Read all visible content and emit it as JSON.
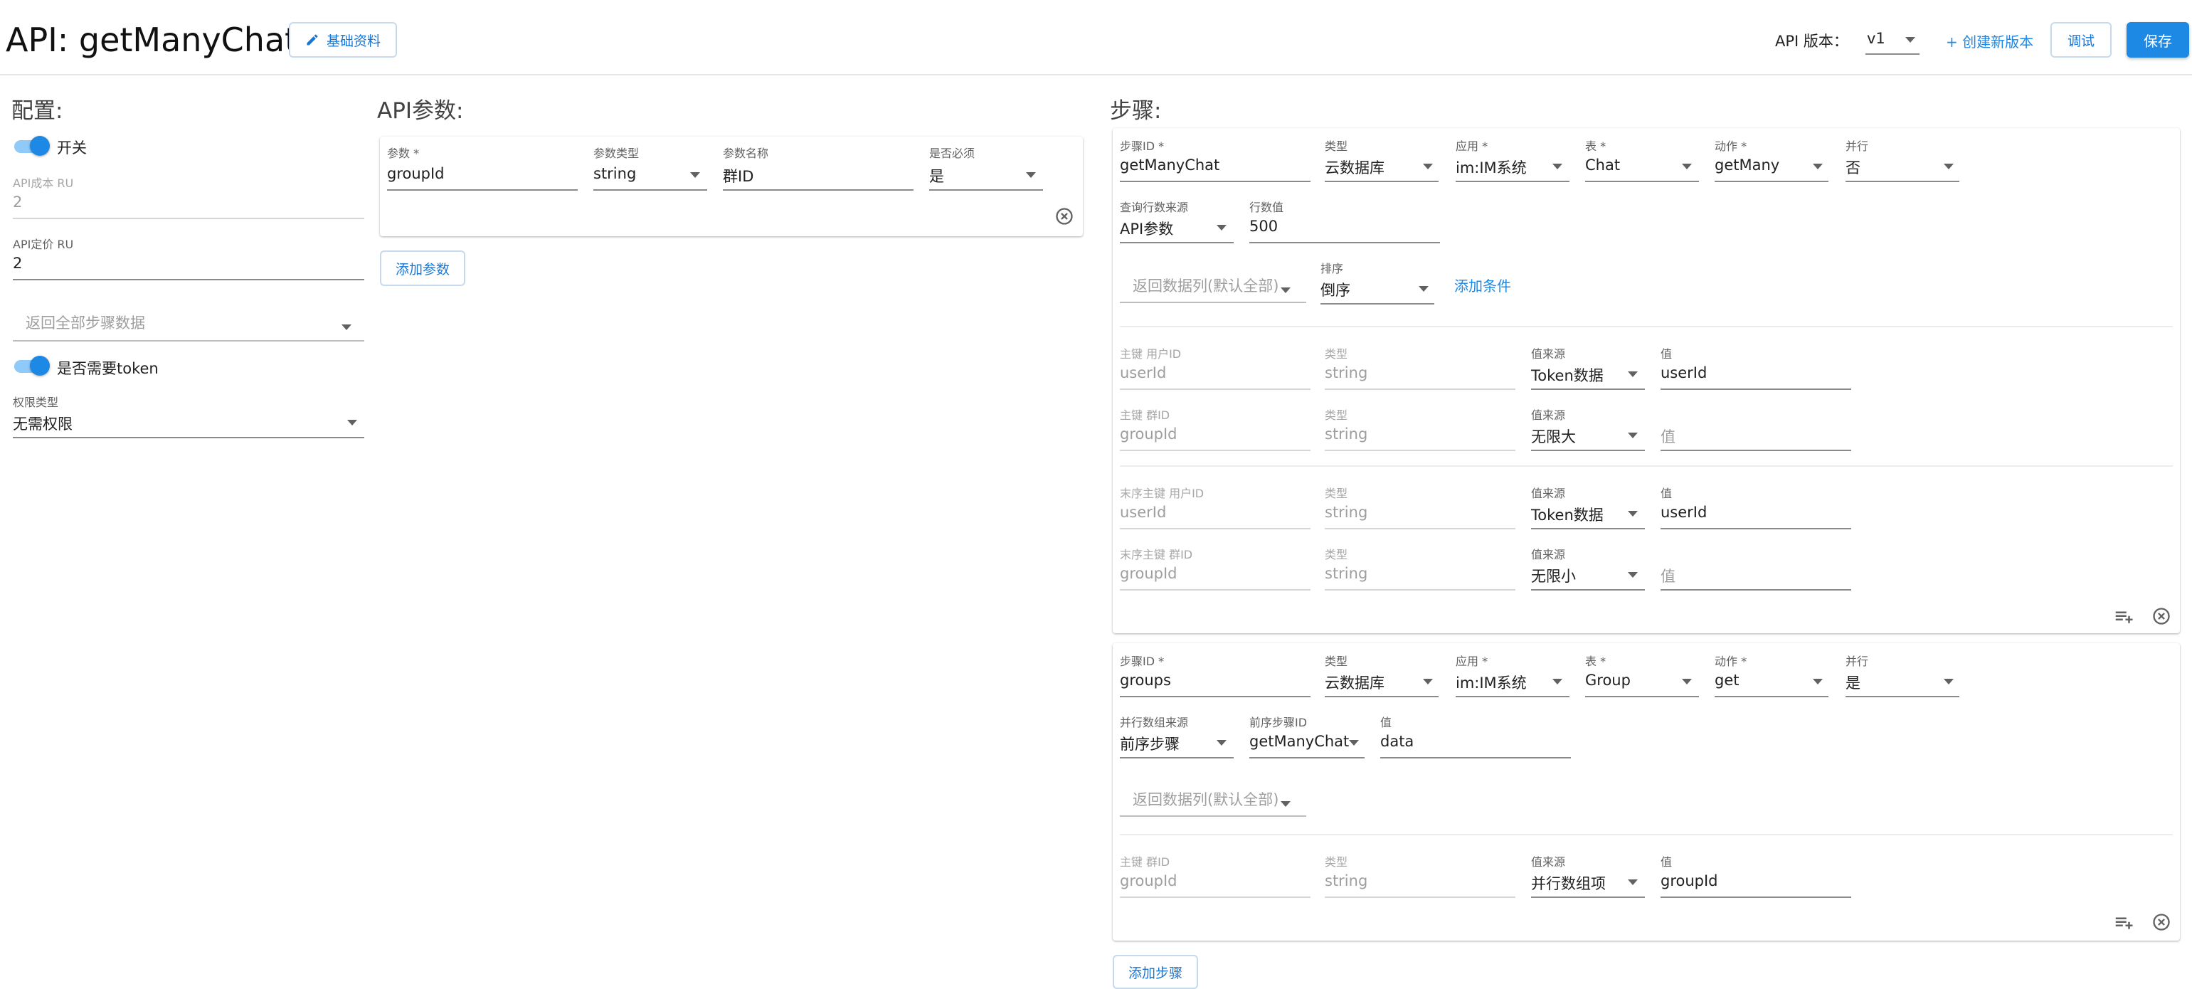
{
  "header": {
    "title": "API: getManyChat",
    "basic_info_label": "基础资料",
    "version_label": "API 版本：",
    "version_value": "v1",
    "create_version_label": "+ 创建新版本",
    "debug_label": "调试",
    "save_label": "保存"
  },
  "config": {
    "title": "配置:",
    "switch_label": "开关",
    "cost_label": "API成本 RU",
    "cost_value": "2",
    "price_label": "API定价 RU",
    "price_value": "2",
    "return_all_label": "返回全部步骤数据",
    "token_label": "是否需要token",
    "perm_label": "权限类型",
    "perm_value": "无需权限"
  },
  "params": {
    "title": "API参数:",
    "col_param": "参数 *",
    "col_type": "参数类型",
    "col_name": "参数名称",
    "col_required": "是否必须",
    "row": {
      "param": "groupId",
      "type": "string",
      "name": "群ID",
      "required": "是"
    },
    "add_label": "添加参数"
  },
  "steps": {
    "title": "步骤:",
    "lbl_step_id": "步骤ID *",
    "lbl_type": "类型",
    "lbl_app": "应用 *",
    "lbl_table": "表 *",
    "lbl_action": "动作 *",
    "lbl_parallel": "并行",
    "step1": {
      "step_id": "getManyChat",
      "type": "云数据库",
      "app": "im:IM系统",
      "table": "Chat",
      "action": "getMany",
      "parallel": "否",
      "rows_source_label": "查询行数来源",
      "rows_source": "API参数",
      "rows_label": "行数值",
      "rows_value": "500",
      "return_cols": "返回数据列(默认全部)",
      "sort_label": "排序",
      "sort_value": "倒序",
      "add_condition": "添加条件",
      "keys": [
        {
          "key_label": "主键 用户ID",
          "key_value": "userId",
          "type_label": "类型",
          "type_value": "string",
          "src_label": "值来源",
          "src_value": "Token数据",
          "val_label": "值",
          "val_value": "userId"
        },
        {
          "key_label": "主键 群ID",
          "key_value": "groupId",
          "type_label": "类型",
          "type_value": "string",
          "src_label": "值来源",
          "src_value": "无限大",
          "val_label": "",
          "val_value": "值"
        },
        {
          "key_label": "末序主键 用户ID",
          "key_value": "userId",
          "type_label": "类型",
          "type_value": "string",
          "src_label": "值来源",
          "src_value": "Token数据",
          "val_label": "值",
          "val_value": "userId"
        },
        {
          "key_label": "末序主键 群ID",
          "key_value": "groupId",
          "type_label": "类型",
          "type_value": "string",
          "src_label": "值来源",
          "src_value": "无限小",
          "val_label": "",
          "val_value": "值"
        }
      ]
    },
    "step2": {
      "step_id": "groups",
      "type": "云数据库",
      "app": "im:IM系统",
      "table": "Group",
      "action": "get",
      "parallel": "是",
      "parallel_src_label": "并行数组来源",
      "parallel_src": "前序步骤",
      "prev_step_label": "前序步骤ID",
      "prev_step": "getManyChat",
      "value_label": "值",
      "value": "data",
      "return_cols": "返回数据列(默认全部)",
      "key": {
        "key_label": "主键 群ID",
        "key_value": "groupId",
        "type_label": "类型",
        "type_value": "string",
        "src_label": "值来源",
        "src_value": "并行数组项",
        "val_label": "值",
        "val_value": "groupId"
      }
    },
    "add_step_label": "添加步骤"
  }
}
